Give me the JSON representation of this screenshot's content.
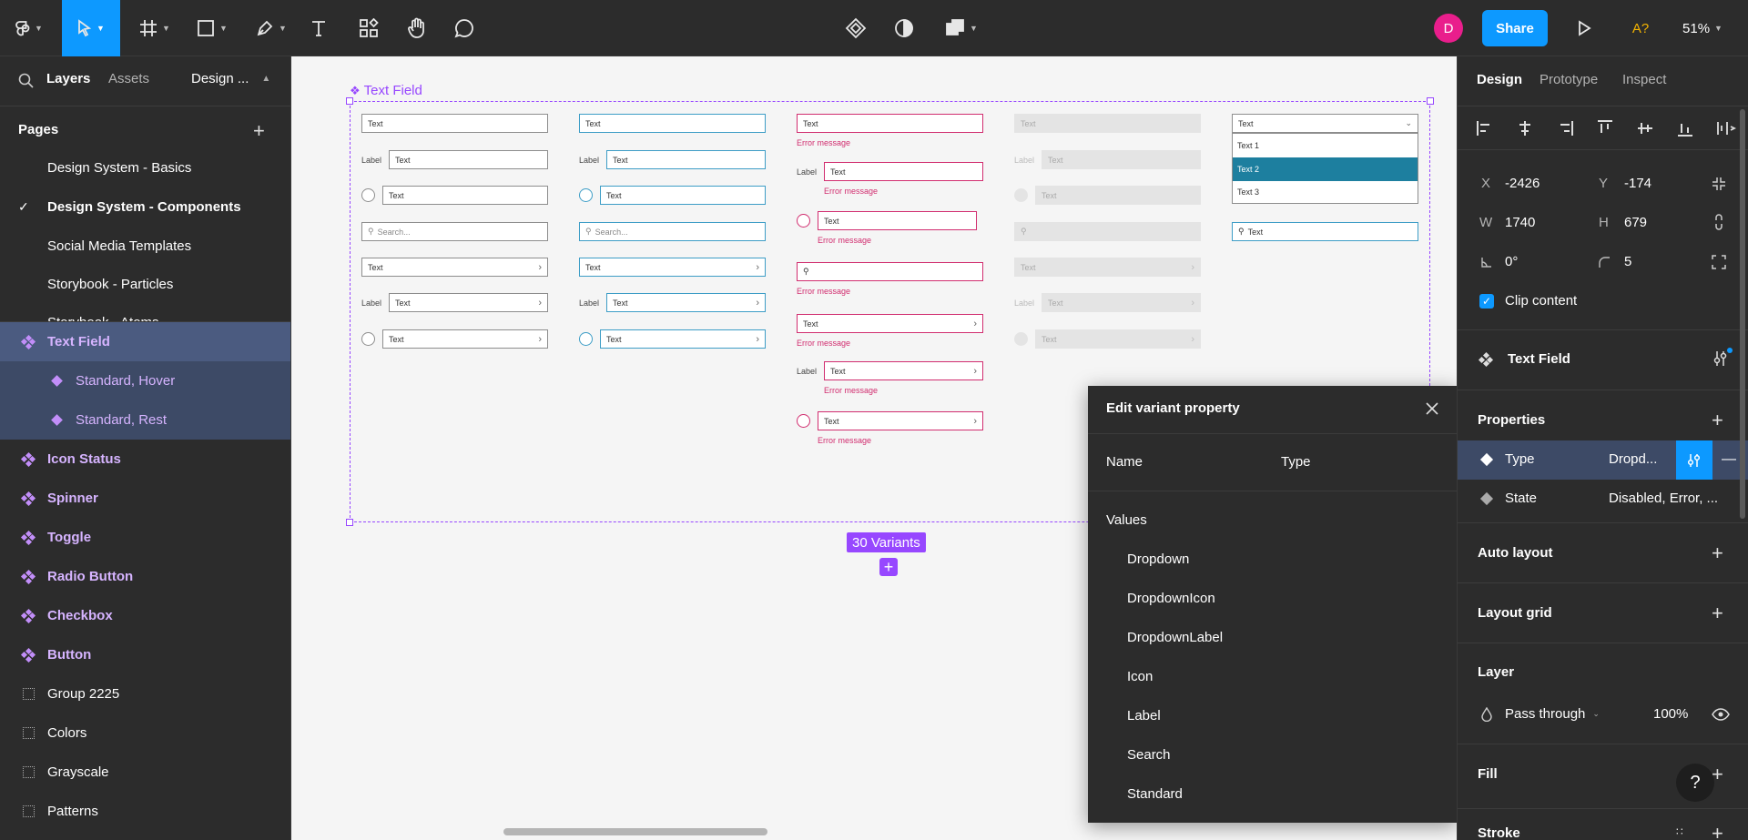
{
  "toolbar": {
    "share": "Share",
    "avatar": "D",
    "font_warning": "A?",
    "zoom": "51%"
  },
  "left_panel": {
    "tabs": {
      "layers": "Layers",
      "assets": "Assets",
      "page": "Design ..."
    },
    "pages_title": "Pages",
    "pages": [
      "Design System - Basics",
      "Design System - Components",
      "Social Media Templates",
      "Storybook - Particles",
      "Storybook - Atoms"
    ],
    "layers": {
      "text_field": "Text Field",
      "standard_hover": "Standard, Hover",
      "standard_rest": "Standard, Rest",
      "icon_status": "Icon Status",
      "spinner": "Spinner",
      "toggle": "Toggle",
      "radio_button": "Radio Button",
      "checkbox": "Checkbox",
      "button": "Button",
      "group": "Group 2225",
      "colors": "Colors",
      "grayscale": "Grayscale",
      "patterns": "Patterns"
    }
  },
  "canvas": {
    "frame_title": "Text Field",
    "variants_badge": "30 Variants",
    "texts": {
      "text": "Text",
      "label": "Label",
      "search": "Search...",
      "error": "Error message",
      "text1": "Text 1",
      "text2": "Text 2",
      "text3": "Text 3"
    }
  },
  "modal": {
    "title": "Edit variant property",
    "name_label": "Name",
    "name_value": "Type",
    "values_label": "Values",
    "values": [
      "Dropdown",
      "DropdownIcon",
      "DropdownLabel",
      "Icon",
      "Label",
      "Search",
      "Standard"
    ]
  },
  "right_panel": {
    "tabs": {
      "design": "Design",
      "prototype": "Prototype",
      "inspect": "Inspect"
    },
    "x_label": "X",
    "x": "-2426",
    "y_label": "Y",
    "y": "-174",
    "w_label": "W",
    "w": "1740",
    "h_label": "H",
    "h": "679",
    "rotation": "0°",
    "radius": "5",
    "clip_content": "Clip content",
    "component_name": "Text Field",
    "properties_title": "Properties",
    "props": [
      {
        "name": "Type",
        "value": "Dropd..."
      },
      {
        "name": "State",
        "value": "Disabled, Error, ..."
      }
    ],
    "auto_layout": "Auto layout",
    "layout_grid": "Layout grid",
    "layer_title": "Layer",
    "blend": "Pass through",
    "opacity": "100%",
    "fill": "Fill",
    "stroke": "Stroke"
  },
  "colors": {
    "accent": "#0d99ff",
    "component": "#c28ef9",
    "frame_selection": "#9747ff",
    "error": "#d12d6f",
    "focus": "#3d9dc6"
  }
}
